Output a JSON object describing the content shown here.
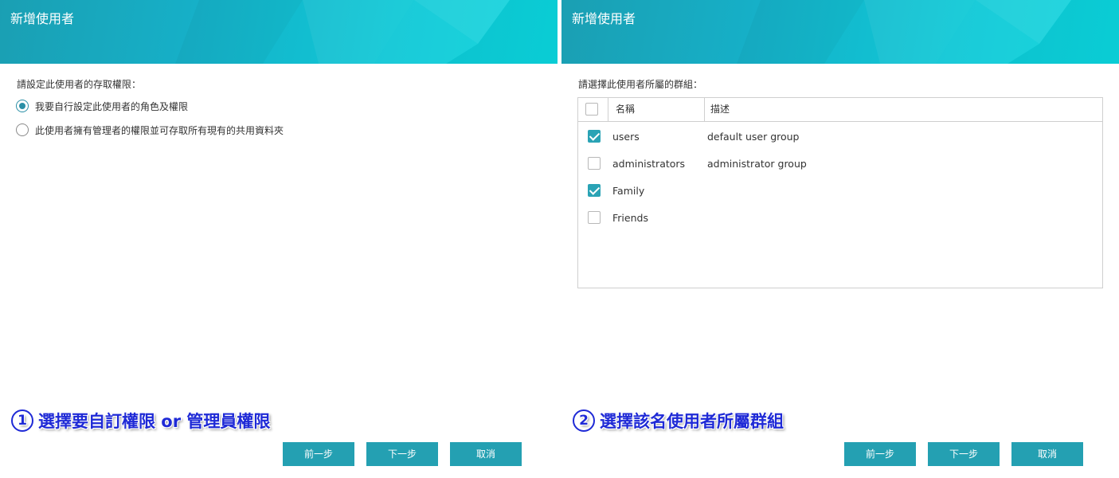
{
  "left": {
    "window_title": "新增使用者",
    "prompt": "請設定此使用者的存取權限：",
    "options": [
      {
        "label": "我要自行設定此使用者的角色及權限",
        "selected": true
      },
      {
        "label": "此使用者擁有管理者的權限並可存取所有現有的共用資料夾",
        "selected": false
      }
    ],
    "annotation": {
      "number": "1",
      "text": "選擇要自訂權限 or 管理員權限"
    },
    "buttons": {
      "back": "前一步",
      "next": "下一步",
      "cancel": "取消"
    }
  },
  "right": {
    "window_title": "新增使用者",
    "prompt": "請選擇此使用者所屬的群組：",
    "table": {
      "header_checked": false,
      "columns": [
        "名稱",
        "描述"
      ],
      "rows": [
        {
          "checked": true,
          "name": "users",
          "description": "default user group"
        },
        {
          "checked": false,
          "name": "administrators",
          "description": "administrator group"
        },
        {
          "checked": true,
          "name": "Family",
          "description": ""
        },
        {
          "checked": false,
          "name": "Friends",
          "description": ""
        }
      ]
    },
    "annotation": {
      "number": "2",
      "text": "選擇該名使用者所屬群組"
    },
    "buttons": {
      "back": "前一步",
      "next": "下一步",
      "cancel": "取消"
    }
  },
  "colors": {
    "accent": "#24a0b2",
    "header_gradient_start": "#1a9fb3",
    "header_gradient_end": "#0bd6de",
    "annotation_blue": "#1f2ad6"
  }
}
